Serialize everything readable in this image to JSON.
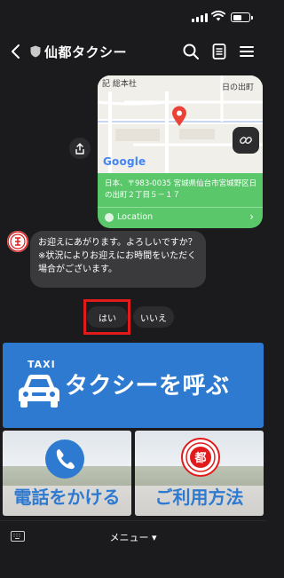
{
  "app": {
    "title": "仙都タクシー"
  },
  "status_bar": {
    "time": ""
  },
  "location_card": {
    "map_label_a": "記 総本社",
    "map_label_b": "日の出町",
    "map_brand": "Google",
    "address": "日本、〒983-0035 宮城県仙台市宮城野区日の出町２丁目５－１７",
    "location_label": "Location"
  },
  "message": {
    "text": "お迎えにあがります。よろしいですか？\n※状況によりお迎えにお時間をいただく場合がございます。"
  },
  "quick_replies": [
    {
      "label": "はい"
    },
    {
      "label": "いいえ"
    }
  ],
  "rich_menu": {
    "taxi_word": "TAXI",
    "taxi_button": "タクシーを呼ぶ",
    "phone_button": "電話をかける",
    "howto_button": "ご利用方法",
    "seal_text": "都"
  },
  "bottom_bar": {
    "menu_label": "メニュー ▾"
  },
  "colors": {
    "accent_blue": "#2f7ad1",
    "location_green": "#59c76a",
    "highlight_red": "#e11b1b"
  }
}
